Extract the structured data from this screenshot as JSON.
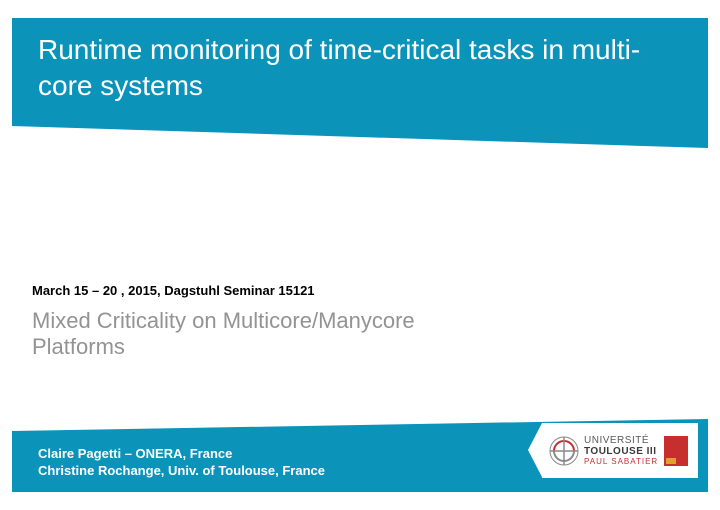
{
  "title": "Runtime monitoring of time-critical tasks in multi-core systems",
  "date_line": "March 15 – 20 , 2015, Dagstuhl Seminar 15121",
  "subtitle_line1": "Mixed Criticality on Multicore/Manycore",
  "subtitle_line2": "Platforms",
  "author1": "Claire Pagetti – ONERA, France",
  "author2": "Christine Rochange, Univ. of Toulouse, France",
  "logo": {
    "line1": "UNIVERSITÉ",
    "line2": "TOULOUSE III",
    "line3": "PAUL SABATIER"
  }
}
